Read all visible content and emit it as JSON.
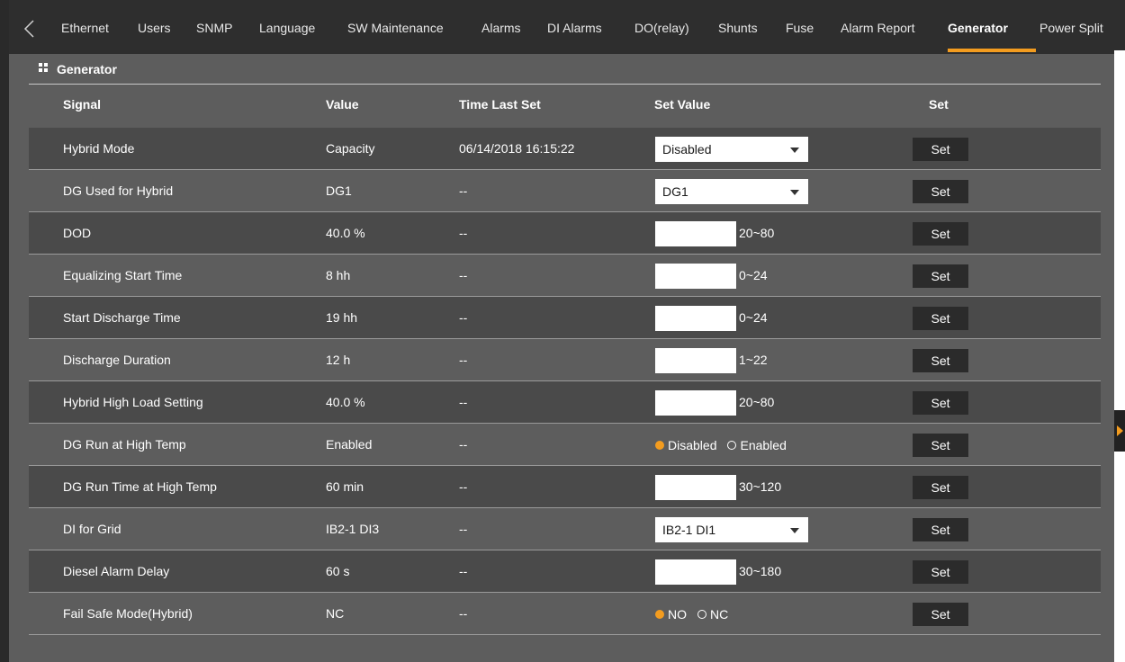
{
  "nav": {
    "tabs": [
      {
        "label": "Ethernet"
      },
      {
        "label": "Users"
      },
      {
        "label": "SNMP"
      },
      {
        "label": "Language"
      },
      {
        "label": "SW Maintenance"
      },
      {
        "label": "Alarms"
      },
      {
        "label": "DI Alarms"
      },
      {
        "label": "DO(relay)"
      },
      {
        "label": "Shunts"
      },
      {
        "label": "Fuse"
      },
      {
        "label": "Alarm Report"
      },
      {
        "label": "Generator"
      },
      {
        "label": "Power Split"
      }
    ],
    "active_tab": "Generator"
  },
  "panel": {
    "title": "Generator",
    "headers": {
      "signal": "Signal",
      "value": "Value",
      "time_last_set": "Time Last Set",
      "set_value": "Set Value",
      "set": "Set"
    },
    "rows": [
      {
        "signal": "Hybrid Mode",
        "value": "Capacity",
        "time": "06/14/2018 16:15:22",
        "control": "select",
        "selected": "Disabled",
        "set_label": "Set"
      },
      {
        "signal": "DG Used for Hybrid",
        "value": "DG1",
        "time": "--",
        "control": "select",
        "selected": "DG1",
        "set_label": "Set"
      },
      {
        "signal": "DOD",
        "value": "40.0 %",
        "time": "--",
        "control": "text",
        "input_value": "",
        "range": "20~80",
        "set_label": "Set"
      },
      {
        "signal": "Equalizing Start Time",
        "value": "8 hh",
        "time": "--",
        "control": "text",
        "input_value": "",
        "range": "0~24",
        "set_label": "Set"
      },
      {
        "signal": "Start Discharge Time",
        "value": "19 hh",
        "time": "--",
        "control": "text",
        "input_value": "",
        "range": "0~24",
        "set_label": "Set"
      },
      {
        "signal": "Discharge Duration",
        "value": "12 h",
        "time": "--",
        "control": "text",
        "input_value": "",
        "range": "1~22",
        "set_label": "Set"
      },
      {
        "signal": "Hybrid High Load Setting",
        "value": "40.0 %",
        "time": "--",
        "control": "text",
        "input_value": "",
        "range": "20~80",
        "set_label": "Set"
      },
      {
        "signal": "DG Run at High Temp",
        "value": "Enabled",
        "time": "--",
        "control": "radio",
        "options": [
          "Disabled",
          "Enabled"
        ],
        "checked": "Disabled",
        "set_label": "Set"
      },
      {
        "signal": "DG Run Time at High Temp",
        "value": "60 min",
        "time": "--",
        "control": "text",
        "input_value": "",
        "range": "30~120",
        "set_label": "Set"
      },
      {
        "signal": "DI for Grid",
        "value": "IB2-1 DI3",
        "time": "--",
        "control": "select",
        "selected": "IB2-1 DI1",
        "set_label": "Set"
      },
      {
        "signal": "Diesel Alarm Delay",
        "value": "60 s",
        "time": "--",
        "control": "text",
        "input_value": "",
        "range": "30~180",
        "set_label": "Set"
      },
      {
        "signal": "Fail Safe Mode(Hybrid)",
        "value": "NC",
        "time": "--",
        "control": "radio",
        "options": [
          "NO",
          "NC"
        ],
        "checked": "NO",
        "set_label": "Set"
      }
    ]
  },
  "colors": {
    "accent": "#f39c1f",
    "panel_bg": "#5d5d5d",
    "row_shade": "#4a4a4a",
    "nav_bg": "#2e2e2e",
    "button_bg": "#2b2b2b"
  }
}
